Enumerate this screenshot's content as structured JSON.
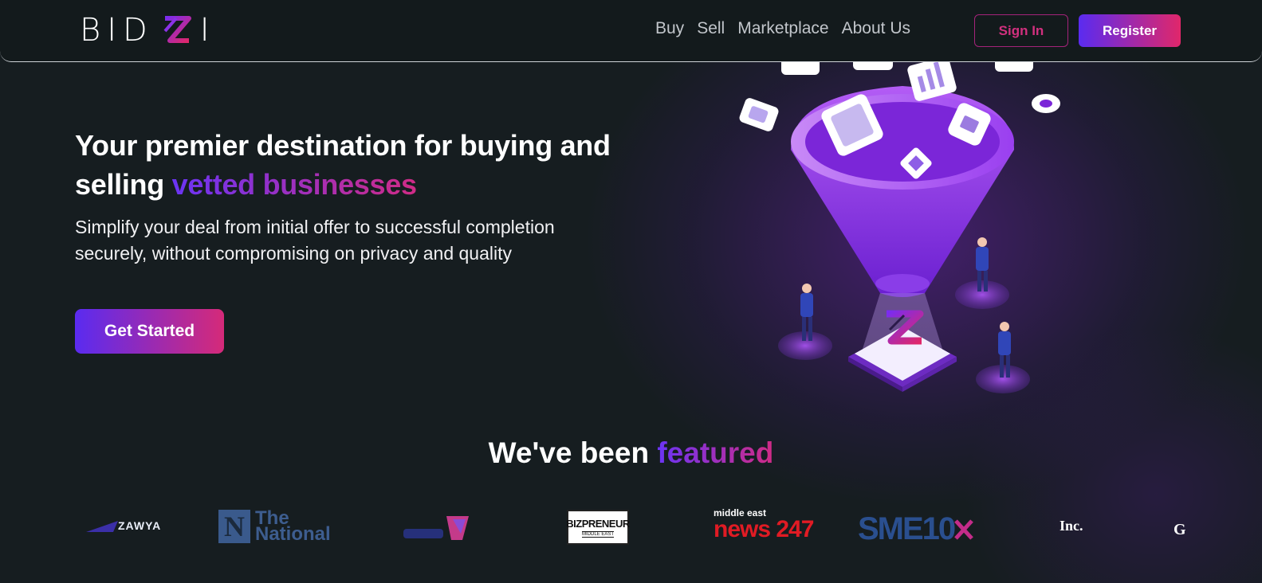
{
  "brand": {
    "logo_text_left": "BID",
    "logo_text_right": "I"
  },
  "nav": {
    "items": [
      "Buy",
      "Sell",
      "Marketplace",
      "About Us"
    ],
    "sign_in": "Sign In",
    "register": "Register"
  },
  "hero": {
    "title_plain": "Your premier destination for buying and selling",
    "title_highlight": "vetted businesses",
    "subtitle": "Simplify your deal from initial offer to successful completion securely, without compromising on privacy and quality",
    "cta": "Get Started"
  },
  "featured": {
    "title_plain": "We've been",
    "title_highlight": "featured",
    "logos": {
      "zawya": "ZAWYA",
      "national_letter": "N",
      "national_line1": "The",
      "national_line2": "National",
      "bizpreneur_main": "BIZPRENEUR",
      "bizpreneur_sub": "MIDDLE EAST",
      "news_top": "middle east",
      "news_main": "news 247",
      "sme": "SME10",
      "inc": "Inc.",
      "g": "G"
    }
  },
  "colors": {
    "accent_start": "#5a2bf0",
    "accent_end": "#e0276a",
    "background": "#161d20"
  }
}
